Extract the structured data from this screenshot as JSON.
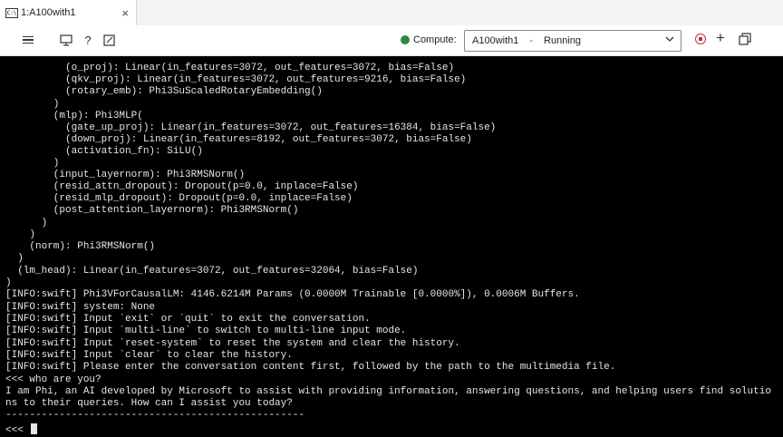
{
  "tab": {
    "icon_label": "C:\\",
    "title": "1:A100with1",
    "close": "×"
  },
  "toolbar": {
    "compute_label": "Compute:",
    "compute_name": "A100with1",
    "compute_separator": "-",
    "compute_status": "Running",
    "status_color": "#2e8b3c"
  },
  "terminal": {
    "lines": [
      "          (o_proj): Linear(in_features=3072, out_features=3072, bias=False)",
      "          (qkv_proj): Linear(in_features=3072, out_features=9216, bias=False)",
      "          (rotary_emb): Phi3SuScaledRotaryEmbedding()",
      "        )",
      "        (mlp): Phi3MLP(",
      "          (gate_up_proj): Linear(in_features=3072, out_features=16384, bias=False)",
      "          (down_proj): Linear(in_features=8192, out_features=3072, bias=False)",
      "          (activation_fn): SiLU()",
      "        )",
      "        (input_layernorm): Phi3RMSNorm()",
      "        (resid_attn_dropout): Dropout(p=0.0, inplace=False)",
      "        (resid_mlp_dropout): Dropout(p=0.0, inplace=False)",
      "        (post_attention_layernorm): Phi3RMSNorm()",
      "      )",
      "    )",
      "    (norm): Phi3RMSNorm()",
      "  )",
      "  (lm_head): Linear(in_features=3072, out_features=32064, bias=False)",
      ")",
      "[INFO:swift] Phi3VForCausalLM: 4146.6214M Params (0.0000M Trainable [0.0000%]), 0.0006M Buffers.",
      "[INFO:swift] system: None",
      "[INFO:swift] Input `exit` or `quit` to exit the conversation.",
      "[INFO:swift] Input `multi-line` to switch to multi-line input mode.",
      "[INFO:swift] Input `reset-system` to reset the system and clear the history.",
      "[INFO:swift] Input `clear` to clear the history.",
      "[INFO:swift] Please enter the conversation content first, followed by the path to the multimedia file.",
      "<<< who are you?",
      "I am Phi, an AI developed by Microsoft to assist with providing information, answering questions, and helping users find solutio",
      "ns to their queries. How can I assist you today?",
      "--------------------------------------------------",
      "<<< "
    ]
  }
}
